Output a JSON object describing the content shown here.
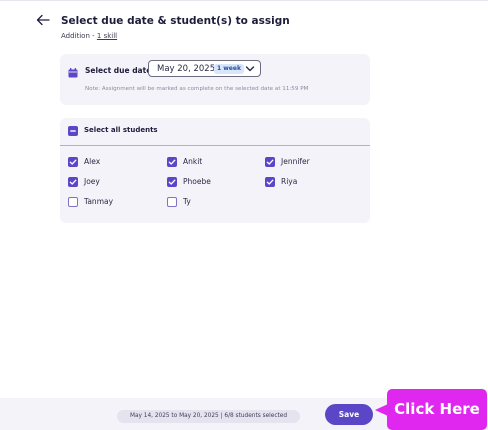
{
  "header": {
    "title": "Select due date & student(s) to assign",
    "subtitle_prefix": "Addition - ",
    "subtitle_link": "1 skill"
  },
  "due_date": {
    "label": "Select due date:",
    "date": "May 20, 2025",
    "badge": "1 week",
    "note": "Note: Assignment will be marked as complete on the selected date at 11:59 PM"
  },
  "students": {
    "select_all_label": "Select all students",
    "list": [
      {
        "name": "Alex",
        "checked": true
      },
      {
        "name": "Ankit",
        "checked": true
      },
      {
        "name": "Jennifer",
        "checked": true
      },
      {
        "name": "Joey",
        "checked": true
      },
      {
        "name": "Phoebe",
        "checked": true
      },
      {
        "name": "Riya",
        "checked": true
      },
      {
        "name": "Tanmay",
        "checked": false
      },
      {
        "name": "Ty",
        "checked": false
      }
    ]
  },
  "footer": {
    "range_text": "May 14, 2025 to May 20, 2025 | 6/8 students selected",
    "save_label": "Save"
  },
  "callout": {
    "text": "Click Here",
    "color": "#df27ef"
  },
  "colors": {
    "accent": "#5b46c7",
    "card_bg": "#f5f3fa"
  }
}
